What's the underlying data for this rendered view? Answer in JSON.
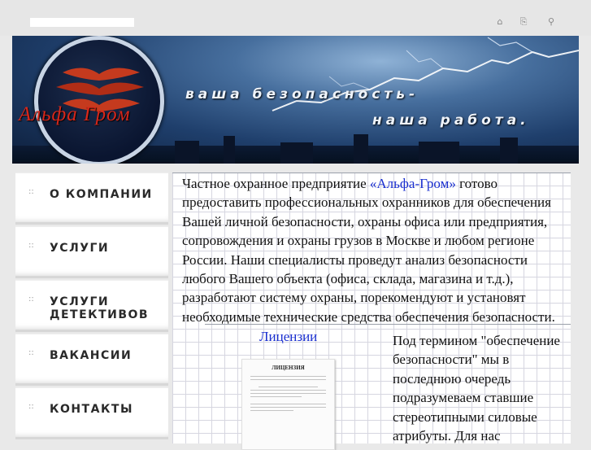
{
  "header": {
    "icons": [
      {
        "name": "home-icon",
        "glyph": "⌂"
      },
      {
        "name": "sitemap-icon",
        "glyph": "⎘"
      },
      {
        "name": "search-icon",
        "glyph": "⚲"
      }
    ]
  },
  "banner": {
    "logo_text": "Альфа Гром",
    "slogan_line1": "ваша безопасность-",
    "slogan_line2": "наша работа."
  },
  "nav": {
    "bullet": "::",
    "items": [
      {
        "label": "О компании"
      },
      {
        "label": "Услуги"
      },
      {
        "label": "Услуги детективов"
      },
      {
        "label": "Вакансии"
      },
      {
        "label": "Контакты"
      }
    ]
  },
  "content": {
    "intro_before": "Частное охранное предприятие ",
    "intro_link": "«Альфа-Гром»",
    "intro_after": " готово предоставить профессиональных охранников для обеспечения Вашей личной безопасности, охраны офиса или предприятия, сопровождения и охраны грузов в Москве и любом регионе России. Наши специалисты проведут анализ безопасности любого Вашего объекта (офиса, склада, магазина и т.д.), разработают систему охраны, порекомендуют и установят необходимые технические средства обеспечения безопасности.",
    "licenses_link": "Лицензии",
    "license_doc_title": "ЛИЦЕНЗИЯ",
    "term_text": "Под термином \"обеспечение безопасности\" мы в последнюю очередь подразумеваем ставшие стереотипными силовые атрибуты. Для нас"
  },
  "colors": {
    "link": "#1a2fcf",
    "logo_text": "#d8271a",
    "background": "#e9e9e9"
  }
}
